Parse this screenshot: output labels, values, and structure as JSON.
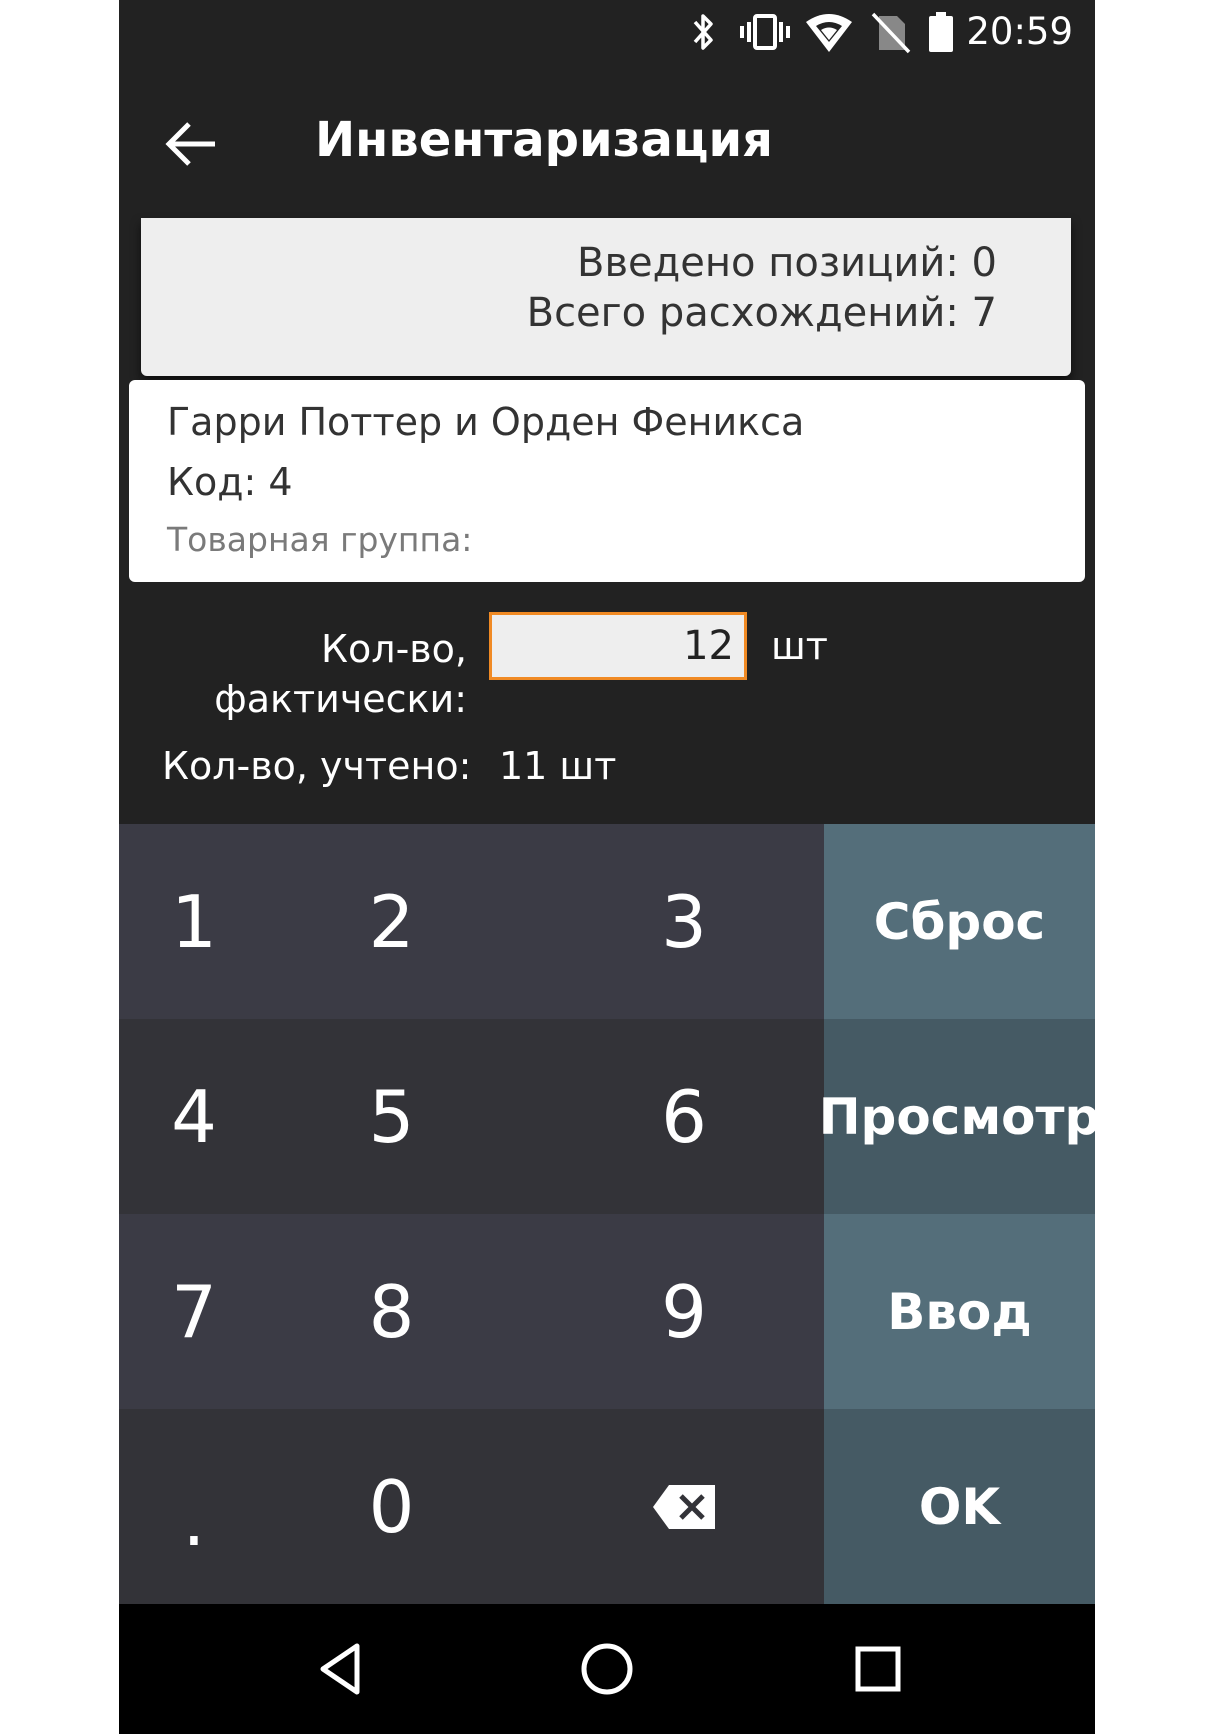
{
  "status_bar": {
    "time": "20:59",
    "icons": [
      "bluetooth-icon",
      "vibrate-icon",
      "wifi-icon",
      "no-sim-icon",
      "battery-icon"
    ]
  },
  "app_bar": {
    "title": "Инвентаризация",
    "back_icon": "arrow-left-icon"
  },
  "summary": {
    "entered_text": "Введено позиций: 0",
    "discrepancies_text": "Всего расхождений: 7"
  },
  "product": {
    "name": "Гарри Поттер и Орден Феникса",
    "code": "Код: 4",
    "group": "Товарная группа:"
  },
  "quantity": {
    "actual_label_line1": "Кол-во,",
    "actual_label_line2": "фактически:",
    "actual_value": "12",
    "unit": "шт",
    "accounted_label": "Кол-во, учтено:",
    "accounted_value": "11 шт"
  },
  "keypad": {
    "keys": [
      "1",
      "2",
      "3",
      "4",
      "5",
      "6",
      "7",
      "8",
      "9",
      ".",
      "0"
    ],
    "reset_label": "Сброс",
    "view_label": "Просмотр",
    "enter_label": "Ввод",
    "ok_label": "OK",
    "backspace_icon": "backspace-icon"
  },
  "nav_bar": {
    "icons": [
      "nav-back-icon",
      "nav-home-icon",
      "nav-recents-icon"
    ]
  },
  "colors": {
    "accent": "#f08a24",
    "action_key_light": "#546e7a",
    "action_key_dark": "#455a64",
    "background": "#222222"
  }
}
